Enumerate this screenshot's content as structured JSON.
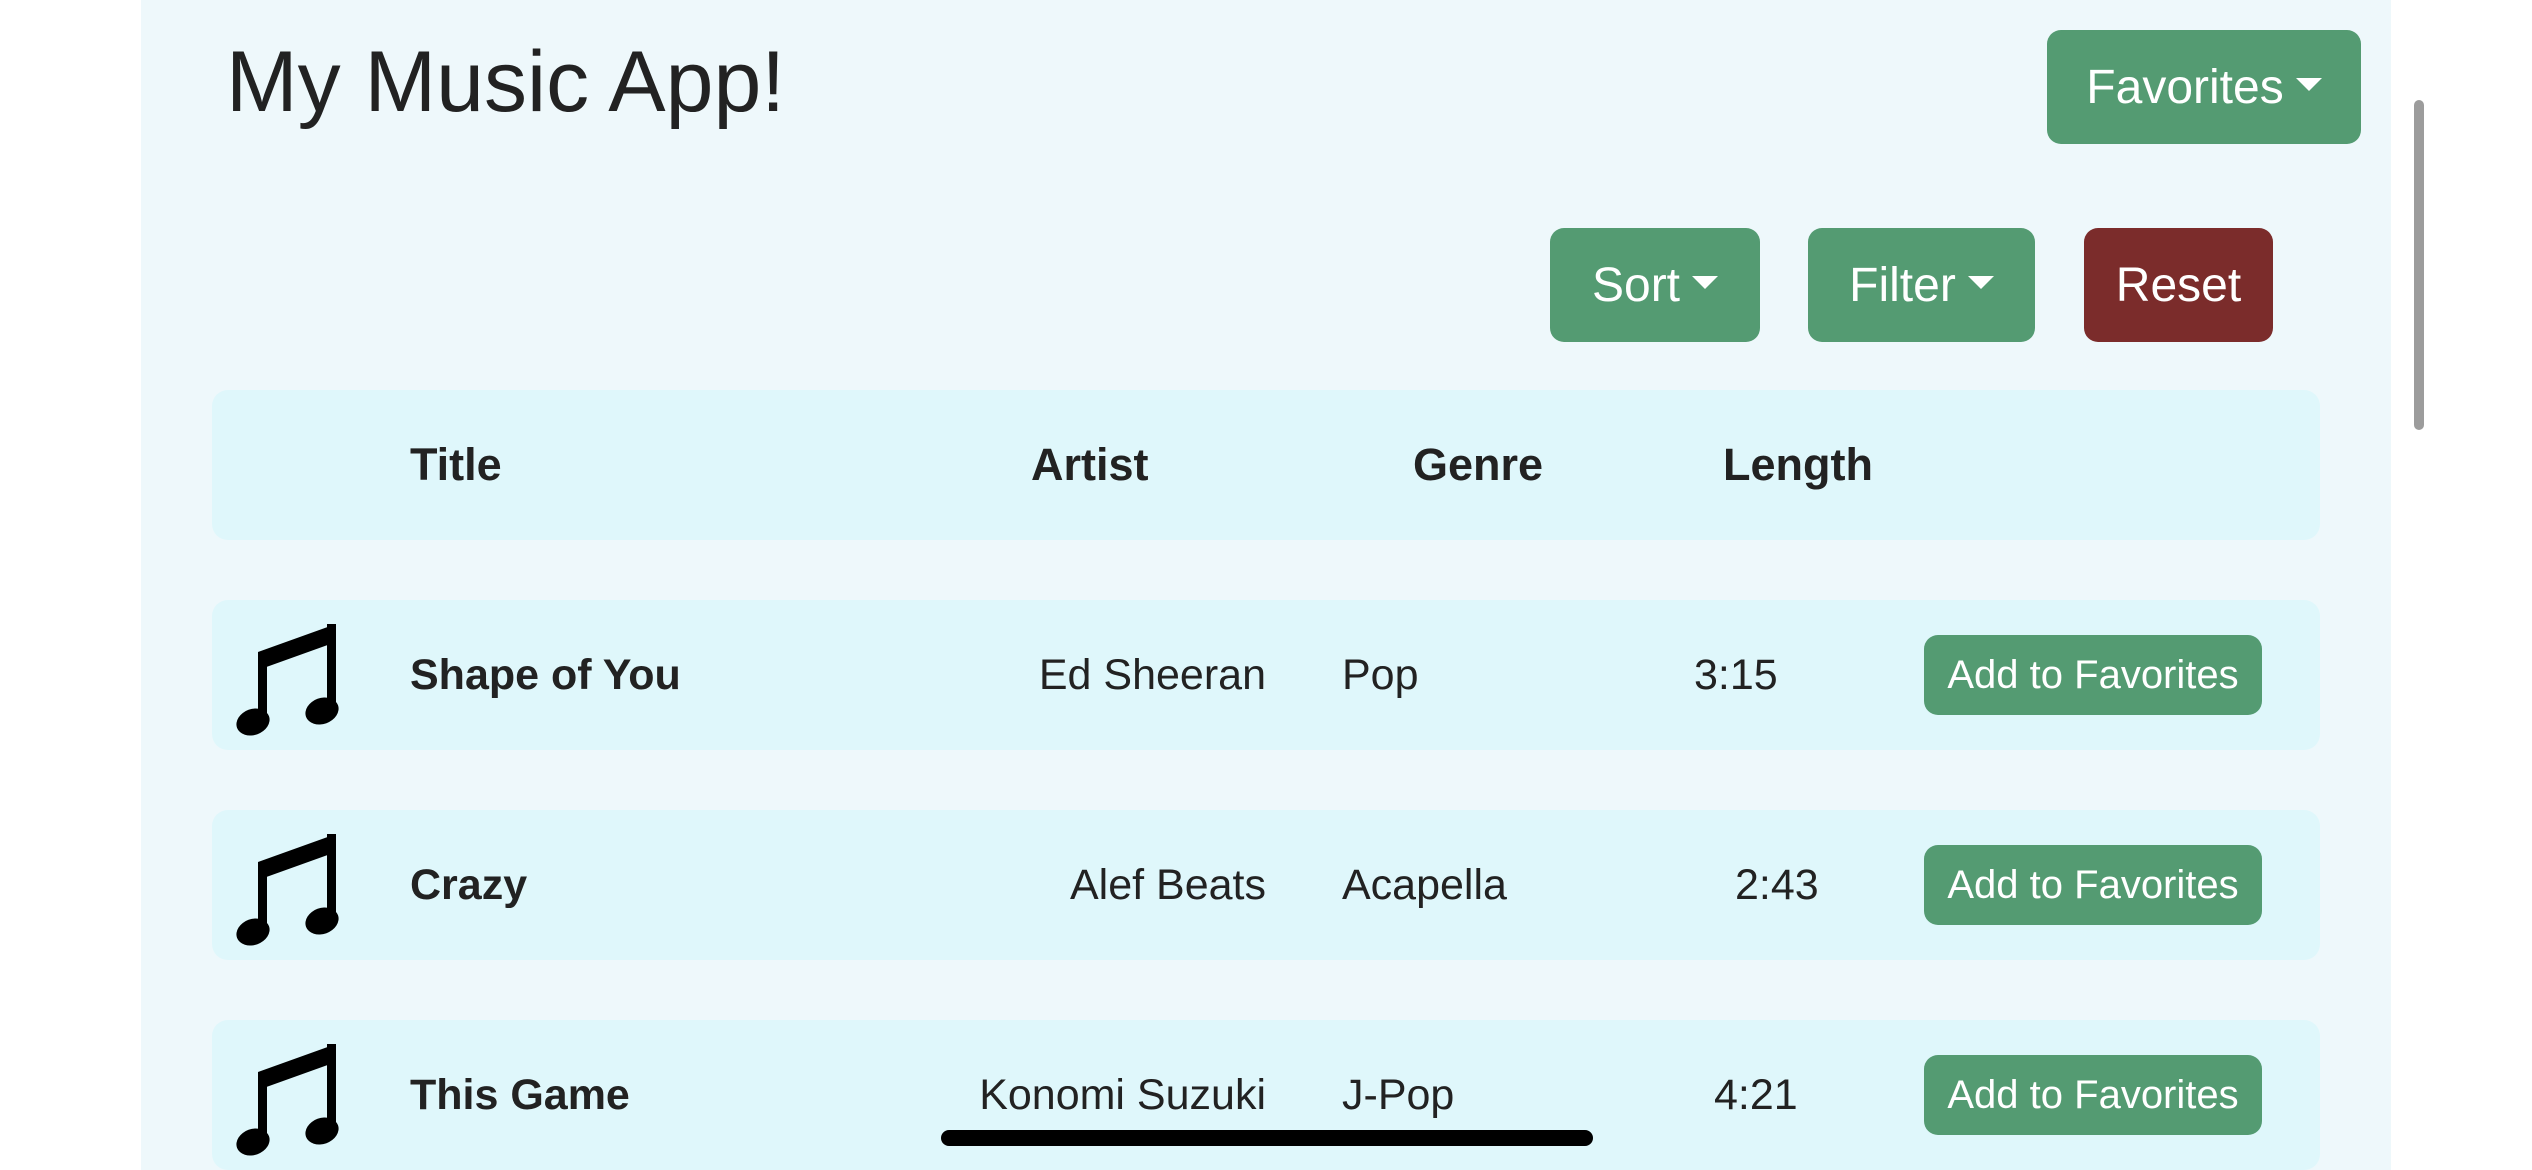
{
  "app": {
    "title": "My Music App!"
  },
  "toolbar": {
    "favorites_label": "Favorites",
    "sort_label": "Sort",
    "filter_label": "Filter",
    "reset_label": "Reset"
  },
  "table": {
    "headers": {
      "title": "Title",
      "artist": "Artist",
      "genre": "Genre",
      "length": "Length"
    },
    "rows": [
      {
        "icon": "music-note-icon",
        "title": "Shape of You",
        "artist": "Ed Sheeran",
        "genre": "Pop",
        "length": "3:15",
        "action": "Add to Favorites"
      },
      {
        "icon": "music-note-icon",
        "title": "Crazy",
        "artist": "Alef Beats",
        "genre": "Acapella",
        "length": "2:43",
        "action": "Add to Favorites"
      },
      {
        "icon": "music-note-icon",
        "title": "This Game",
        "artist": "Konomi Suzuki",
        "genre": "J-Pop",
        "length": "4:21",
        "action": "Add to Favorites"
      }
    ]
  },
  "colors": {
    "panel_background": "#eef8fb",
    "row_background": "#dff7fb",
    "primary_button": "#549b72",
    "reset_button": "#7b2c2b",
    "text": "#222222"
  }
}
